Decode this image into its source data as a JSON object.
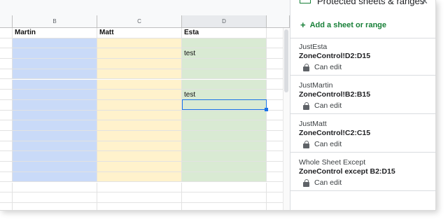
{
  "columns": [
    {
      "letter": "B",
      "header": "Martin",
      "color": "#c9daf8"
    },
    {
      "letter": "C",
      "header": "Matt",
      "color": "#fff2cc"
    },
    {
      "letter": "D",
      "header": "Esta",
      "color": "#d9ead3"
    }
  ],
  "cells": {
    "d3": "test",
    "d7": "test"
  },
  "panel": {
    "title": "Protected sheets & ranges",
    "add_label": "Add a sheet or range",
    "items": [
      {
        "name": "JustEsta",
        "range": "ZoneControl!D2:D15",
        "permission": "Can edit"
      },
      {
        "name": "JustMartin",
        "range": "ZoneControl!B2:B15",
        "permission": "Can edit"
      },
      {
        "name": "JustMatt",
        "range": "ZoneControl!C2:C15",
        "permission": "Can edit"
      },
      {
        "name": "Whole Sheet Except",
        "range": "ZoneControl except B2:D15",
        "permission": "Can edit"
      }
    ]
  },
  "colors": {
    "accent_green": "#188038",
    "selection_blue": "#1a73e8"
  }
}
